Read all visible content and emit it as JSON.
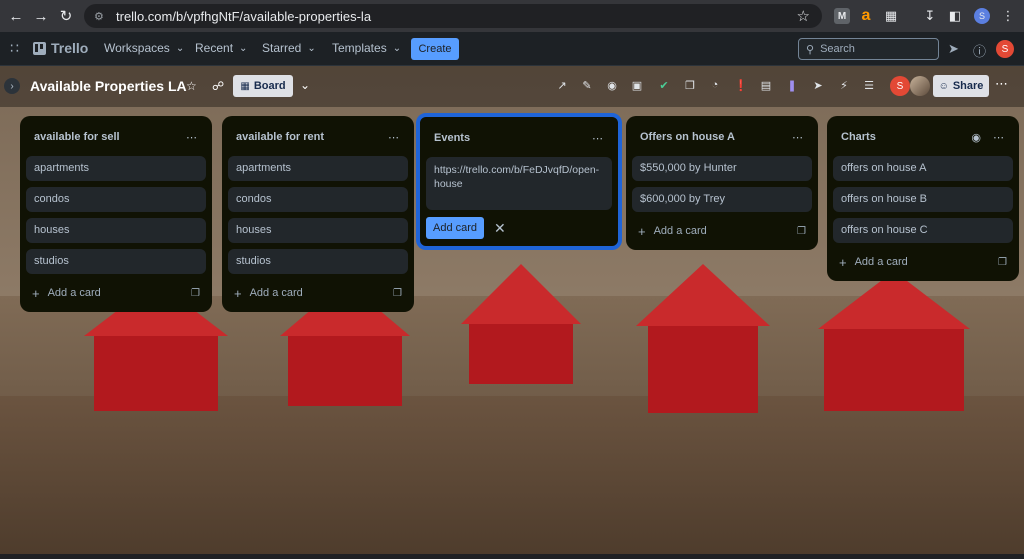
{
  "browser": {
    "url": "trello.com/b/vpfhgNtF/available-properties-la",
    "back_icon": "arrow-left-icon",
    "forward_icon": "arrow-right-icon",
    "reload_icon": "reload-icon",
    "ext_m_label": "M",
    "ext_a_label": "a",
    "profile_initial": "S"
  },
  "header": {
    "logo_text": "Trello",
    "menus": [
      "Workspaces",
      "Recent",
      "Starred",
      "Templates"
    ],
    "create_label": "Create",
    "search_placeholder": "Search",
    "avatar_initial": "S"
  },
  "board": {
    "title": "Available Properties LA",
    "view_label": "Board",
    "share_label": "Share",
    "member_initial": "S"
  },
  "lists": [
    {
      "title": "available for sell",
      "cards": [
        "apartments",
        "condos",
        "houses",
        "studios"
      ],
      "add_label": "Add a card"
    },
    {
      "title": "available for rent",
      "cards": [
        "apartments",
        "condos",
        "houses",
        "studios"
      ],
      "add_label": "Add a card"
    },
    {
      "title": "Events",
      "composer_text": "https://trello.com/b/FeDJvqfD/open-house",
      "add_button_label": "Add card"
    },
    {
      "title": "Offers on house A",
      "cards": [
        "$550,000 by Hunter",
        "$600,000 by Trey"
      ],
      "add_label": "Add a card"
    },
    {
      "title": "Charts",
      "cards": [
        "offers on house A",
        "offers on house B",
        "offers on house C"
      ],
      "add_label": "Add a card"
    }
  ],
  "colors": {
    "accent": "#579dff",
    "list_bg": "#101204",
    "card_bg": "#22272b",
    "focus_border": "#1f64d8",
    "house_red": "#b2191e"
  }
}
